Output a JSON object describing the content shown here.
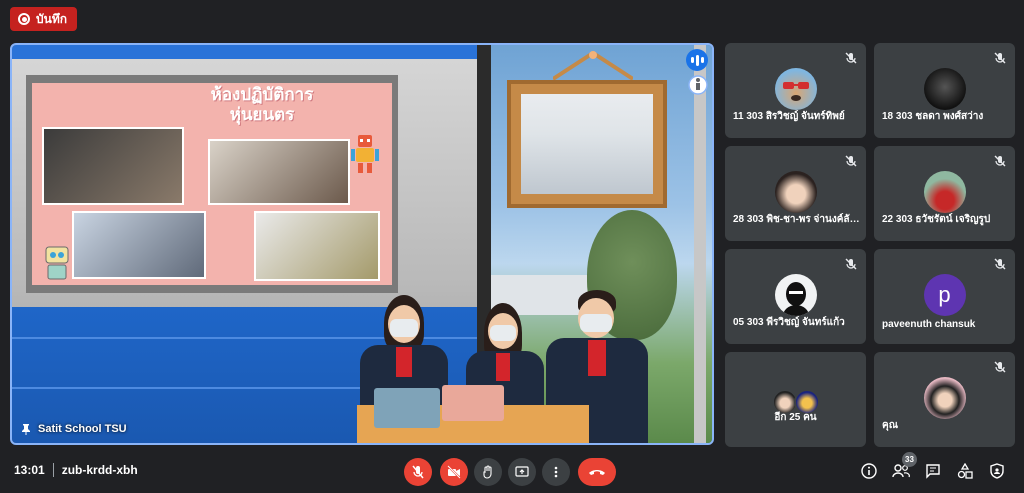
{
  "recording": {
    "label": "บันทึก"
  },
  "main_video": {
    "name": "Satit School TSU",
    "slide_title_line1": "ห้องปฏิบัติการ",
    "slide_title_line2": "หุ่นยนตร"
  },
  "participants": [
    {
      "name": "11 303 สิรวิชญ์ จันทร์ทิพย์",
      "avatar": "dog-sunglasses-photo"
    },
    {
      "name": "18 303 ชลดา พงศ์สว่าง",
      "avatar": "dark-character-photo"
    },
    {
      "name": "28 303 พิช-ชา-พร จ่านงค์ลักษ...",
      "avatar": "girl-photo"
    },
    {
      "name": "22 303 ธวัชรัตน์ เจริญรูป",
      "avatar": "red-shirt-photo"
    },
    {
      "name": "05 303 พีรวิชญ์ จันทร์แก้ว",
      "avatar": "masked-figure-photo"
    },
    {
      "name": "paveenuth chansuk",
      "avatar_letter": "p",
      "avatar_color": "#5e35b1"
    },
    {
      "name": "อีก 25 คน",
      "avatar": "group-avatars"
    },
    {
      "name": "คุณ",
      "avatar": "self-photo"
    }
  ],
  "bottom_bar": {
    "time": "13:01",
    "meeting_code": "zub-krdd-xbh",
    "participant_count": "33"
  },
  "colors": {
    "background": "#202124",
    "tile": "#3c4043",
    "danger": "#ea4335",
    "active_border": "#8ab4f8",
    "speaking": "#1a73e8"
  }
}
